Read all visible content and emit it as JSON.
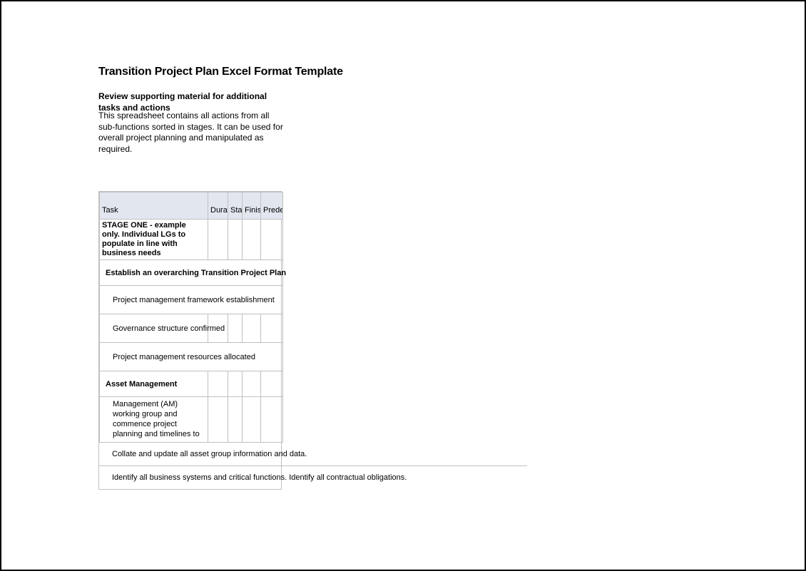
{
  "title": "Transition Project Plan Excel Format Template",
  "subtitle_bold": "Review supporting material for additional tasks and actions",
  "subtitle_desc": "This spreadsheet contains all actions from all sub-functions sorted in stages. It can be used for overall project planning and manipulated as required.",
  "headers": {
    "task": "Task",
    "duration": "Duration",
    "start": "Start",
    "finish": "Finish",
    "predecessors": "Predecessors"
  },
  "stage_row": "STAGE ONE - example only. Individual LGs to populate in line with business needs",
  "section1": "Establish an overarching Transition Project Plan",
  "sub1": "Project management framework establishment",
  "sub2": "Governance structure confirmed",
  "sub3": "Project management resources allocated",
  "section2": "Asset Management",
  "mgmt_row": "Management (AM) working group and commence project planning and timelines to",
  "overflow1": "Collate and update all asset group information and data.",
  "overflow2": "Identify all business systems and critical functions. Identify all contractual obligations."
}
